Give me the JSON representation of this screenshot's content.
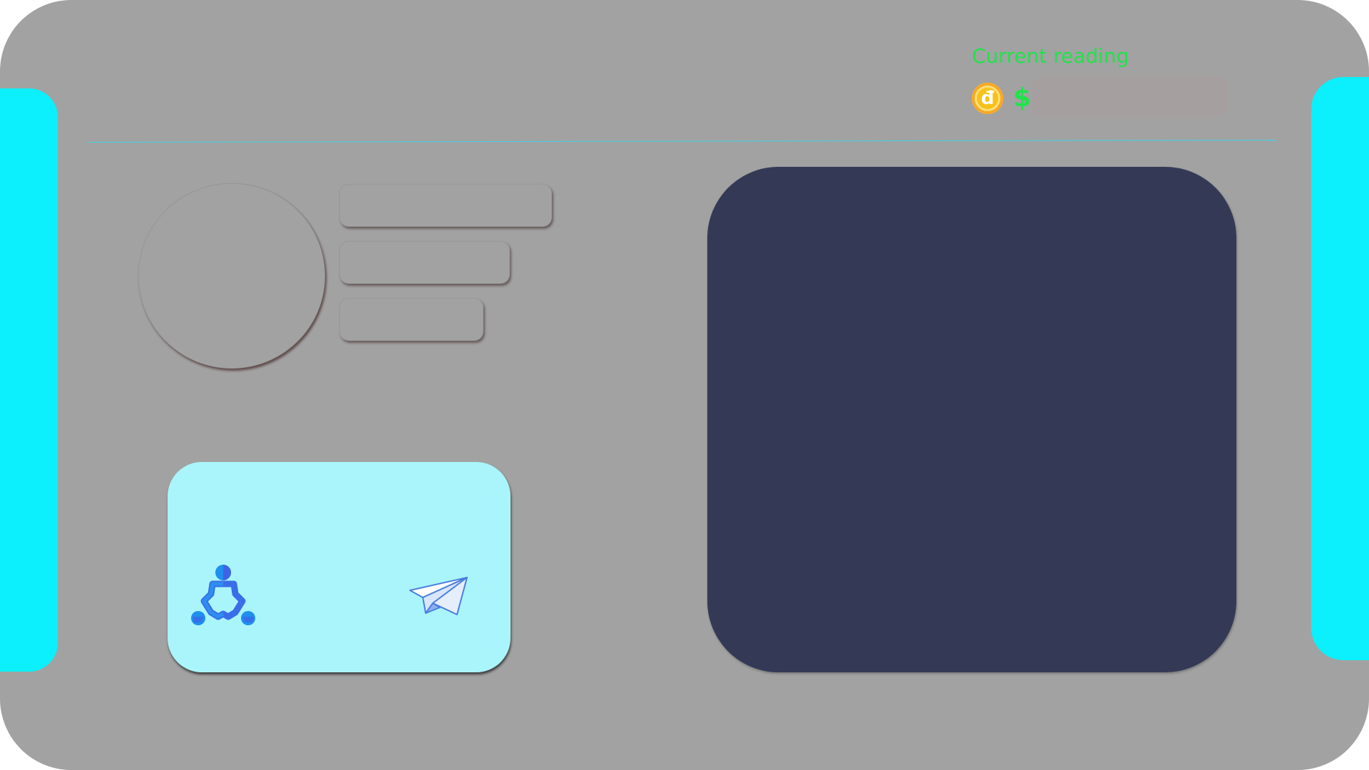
{
  "reading": {
    "label": "Current reading",
    "coin_icon": "coin-icon",
    "coin_glyph": "đ",
    "currency_symbol": "$",
    "value": ""
  },
  "action_card": {
    "icons": [
      "team-icon",
      "paper-plane-icon"
    ]
  },
  "colors": {
    "background": "#a2a2a2",
    "side_accent": "#0ceffc",
    "label_green": "#20e34a",
    "screen": "#343a56",
    "card": "#aaf5fb",
    "coin": "#f6c21a"
  }
}
